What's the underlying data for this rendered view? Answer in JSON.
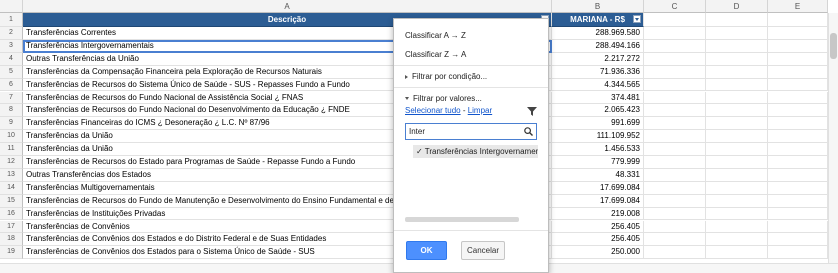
{
  "columns": {
    "corner": "",
    "a": "A",
    "b": "B",
    "c": "C",
    "d": "D",
    "e": "E"
  },
  "header": {
    "row": "1",
    "descricao": "Descrição",
    "mariana": "MARIANA - R$"
  },
  "rows": [
    {
      "n": "2",
      "desc": "Transferências Correntes",
      "val": "288.969.580"
    },
    {
      "n": "3",
      "desc": "Transferências Intergovernamentais",
      "val": "288.494.166"
    },
    {
      "n": "4",
      "desc": "Outras Transferências da União",
      "val": "2.217.272"
    },
    {
      "n": "5",
      "desc": "Transferências da Compensação Financeira pela Exploração de Recursos Naturais",
      "val": "71.936.336"
    },
    {
      "n": "6",
      "desc": "Transferências de Recursos do Sistema Único de Saúde - SUS - Repasses Fundo a Fundo",
      "val": "4.344.565"
    },
    {
      "n": "7",
      "desc": "Transferências de Recursos do Fundo Nacional de Assistência Social ¿ FNAS",
      "val": "374.481"
    },
    {
      "n": "8",
      "desc": "Transferências de Recursos do Fundo Nacional do Desenvolvimento da Educação ¿ FNDE",
      "val": "2.065.423"
    },
    {
      "n": "9",
      "desc": "Transferências Financeiras do ICMS ¿ Desoneração ¿ L.C. Nº 87/96",
      "val": "991.699"
    },
    {
      "n": "10",
      "desc": "Transferências da União",
      "val": "111.109.952"
    },
    {
      "n": "11",
      "desc": "Transferências da União",
      "val": "1.456.533"
    },
    {
      "n": "12",
      "desc": "Transferências de Recursos do Estado para Programas de Saúde - Repasse Fundo a Fundo",
      "val": "779.999"
    },
    {
      "n": "13",
      "desc": "Outras Transferências dos Estados",
      "val": "48.331"
    },
    {
      "n": "14",
      "desc": "Transferências Multigovernamentais",
      "val": "17.699.084"
    },
    {
      "n": "15",
      "desc": "Transferências de Recursos do Fundo de Manutenção e Desenvolvimento do Ensino Fundamental e de Valorização",
      "val": "17.699.084"
    },
    {
      "n": "16",
      "desc": "Transferências de Instituições Privadas",
      "val": "219.008"
    },
    {
      "n": "17",
      "desc": "Transferências de Convênios",
      "val": "256.405"
    },
    {
      "n": "18",
      "desc": "Transferências de Convênios dos Estados e do Distrito Federal e de Suas Entidades",
      "val": "256.405"
    },
    {
      "n": "19",
      "desc": "Transferências de Convênios dos Estados para o Sistema Único de Saúde - SUS",
      "val": "250.000"
    }
  ],
  "popup": {
    "sort_az": "Classificar A → Z",
    "sort_za": "Classificar Z → A",
    "filter_condition": "Filtrar por condição...",
    "filter_values": "Filtrar por valores...",
    "select_all": "Selecionar tudo",
    "dash": " - ",
    "clear": "Limpar",
    "search_value": "Inter",
    "value_item": "✓ Transferências Intergovernamentais",
    "ok": "OK",
    "cancel": "Cancelar"
  }
}
